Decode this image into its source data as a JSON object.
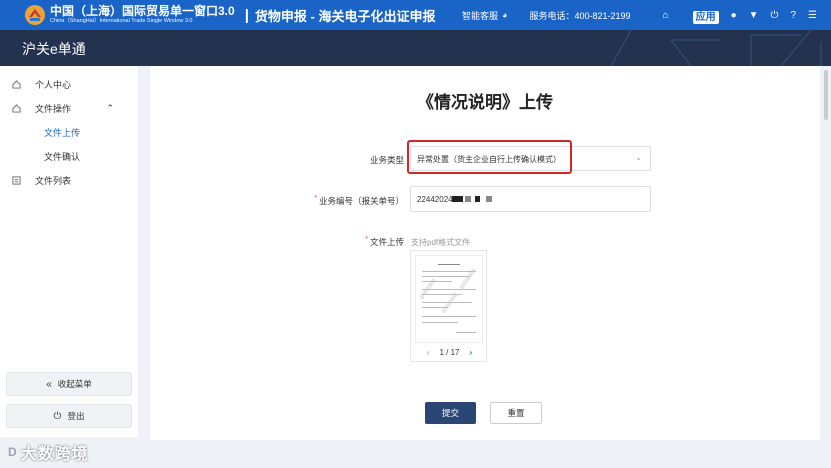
{
  "header": {
    "brand_cn": "中国（上海）国际贸易单一窗口3.0",
    "brand_en": "China（ShangHai）International Trade Single Window 3.0",
    "divider": "|",
    "system_title": "货物申报 - 海关电子化出证申报",
    "service_label": "智能客服",
    "phone": "服务电话：400-821-2199",
    "icons": [
      "home-icon",
      "apps-badge",
      "user-icon",
      "shirt-icon",
      "power-icon",
      "help-icon",
      "menu-icon"
    ],
    "apps_badge_label": "应用"
  },
  "banner": {
    "title": "沪关e单通"
  },
  "sidebar": {
    "items": [
      {
        "label": "个人中心",
        "icon": "home-outline-icon"
      },
      {
        "label": "文件操作",
        "icon": "home-outline-icon"
      },
      {
        "label": "文件上传"
      },
      {
        "label": "文件确认"
      },
      {
        "label": "文件列表",
        "icon": "list-icon"
      }
    ],
    "collapse_label": "收起菜单",
    "logout_label": "登出"
  },
  "main": {
    "title": "《情况说明》上传",
    "business_type_label": "业务类型",
    "business_type_value": "异常处置（货主企业自行上传确认模式）",
    "business_no_label": "业务编号（报关单号）",
    "business_no_value": "22442024",
    "file_upload_label": "文件上传",
    "file_hint": "支持pdf格式文件",
    "pager_current": "1 / 17",
    "submit_label": "提交",
    "reset_label": "重置"
  },
  "watermark": {
    "logo": "D",
    "text": "大数跨境"
  },
  "colors": {
    "header_blue": "#1a64c8",
    "banner_navy": "#23324f",
    "submit_navy": "#2a4674",
    "highlight_red": "#d82424"
  }
}
